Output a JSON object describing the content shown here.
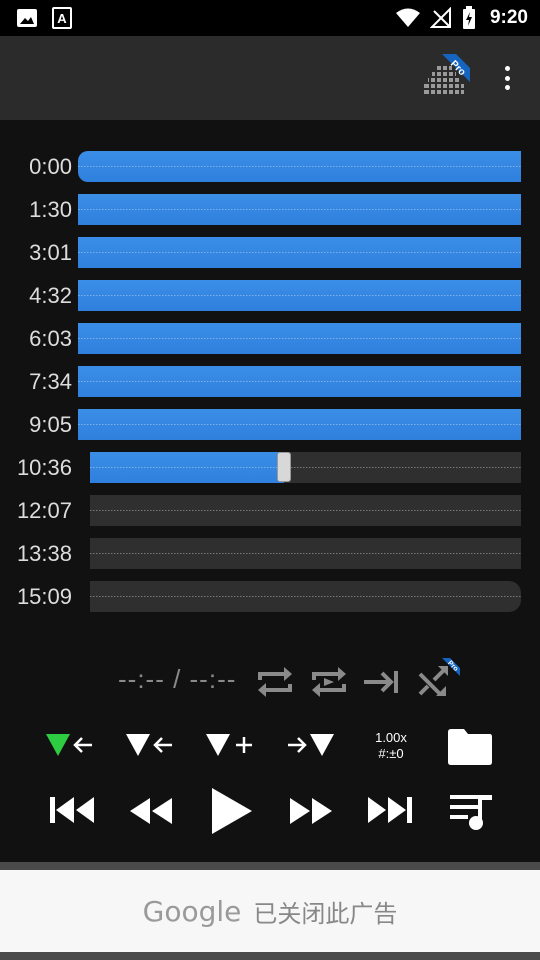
{
  "status": {
    "time": "9:20"
  },
  "waveform": {
    "rows": [
      {
        "time": "0:00",
        "fill": 1.0
      },
      {
        "time": "1:30",
        "fill": 1.0
      },
      {
        "time": "3:01",
        "fill": 1.0
      },
      {
        "time": "4:32",
        "fill": 1.0
      },
      {
        "time": "6:03",
        "fill": 1.0
      },
      {
        "time": "7:34",
        "fill": 1.0
      },
      {
        "time": "9:05",
        "fill": 1.0
      },
      {
        "time": "10:36",
        "fill": 0.45
      },
      {
        "time": "12:07",
        "fill": 0
      },
      {
        "time": "13:38",
        "fill": 0
      },
      {
        "time": "15:09",
        "fill": 0
      }
    ]
  },
  "player": {
    "position_text": "--:-- / --:--",
    "speed": "1.00x",
    "pitch": "#:±0"
  },
  "ad": {
    "brand": "Google",
    "message": "已关闭此广告"
  },
  "colors": {
    "accent": "#3b8ee6",
    "marker": "#2ecc40"
  }
}
